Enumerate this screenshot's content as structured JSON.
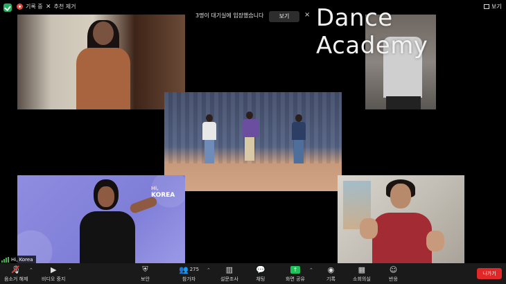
{
  "topbar": {
    "recording_label": "기록 중",
    "unfollow_label": "추천 제거",
    "waiting_message": "3명이 대기실에 입장했습니다",
    "view_button": "보기",
    "close": "×",
    "view_label": "보기"
  },
  "watermark": "Dance Academy",
  "participant_name": "Hi, Korea",
  "korea_logo": {
    "line1": "Hi,",
    "line2": "KOREA"
  },
  "toolbar": {
    "mute": "음소거 해제",
    "video": "비디오 중지",
    "security": "보안",
    "participants": "참가자",
    "participants_count": "275",
    "polls": "설문조사",
    "chat": "채팅",
    "share": "화면 공유",
    "record": "기록",
    "breakout": "소회의실",
    "reactions": "반응",
    "leave": "나가기"
  },
  "colors": {
    "share_green": "#1fc15a",
    "leave_red": "#e02828",
    "recording_red": "#e04b3f"
  }
}
